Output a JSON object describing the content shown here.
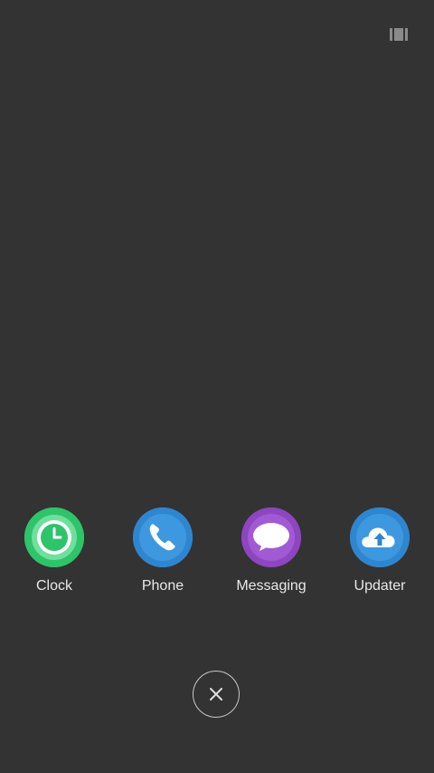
{
  "apps": [
    {
      "label": "Clock",
      "icon": "clock-icon",
      "color": "#2ec46a"
    },
    {
      "label": "Phone",
      "icon": "phone-icon",
      "color": "#2f86d0"
    },
    {
      "label": "Messaging",
      "icon": "chat-bubble-icon",
      "color": "#8e45c0"
    },
    {
      "label": "Updater",
      "icon": "cloud-upload-icon",
      "color": "#2f86d0"
    }
  ],
  "top_right": {
    "icon": "recents-view-toggle-icon"
  },
  "close": {
    "icon": "close-icon"
  },
  "colors": {
    "background": "#333333",
    "label_text": "#e8e8e8"
  }
}
